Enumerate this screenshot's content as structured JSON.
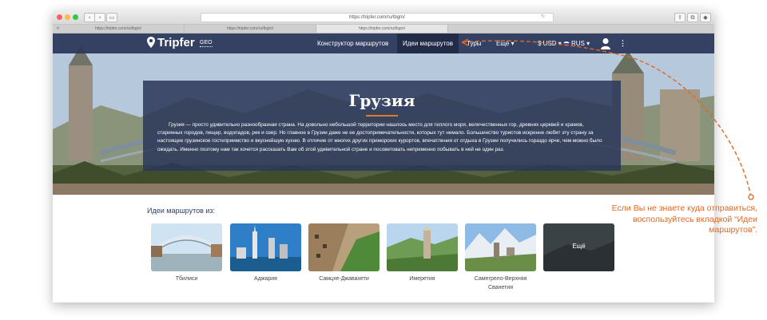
{
  "browser": {
    "url": "https://tripfer.com/ru/tbgm/",
    "tabs": [
      "https://tripfer.com/ru/tbgm/",
      "https://tripfer.com/ru/tbgm/",
      "https://tripfer.com/ru/tbgm/"
    ]
  },
  "site": {
    "brand": "Tripfer",
    "region": "GEO",
    "nav": {
      "constructor": "Конструктор маршрутов",
      "ideas": "Идеи маршрутов",
      "tours": "Туры",
      "more": "Ещё ▾",
      "currency": "$ USD ▾",
      "language": "RUS ▾"
    }
  },
  "hero": {
    "title": "Грузия",
    "description": "Грузия — просто удивительно разнообразная страна. На довольно небольшой территории нашлось место для теплого моря, величественных гор, древних церквей и храмов, старинных городов, пещер, водопадов, рек и озер. Но главное в Грузии даже не ее достопримечательности, которых тут немало. Большинство туристов искренне любят эту страну за настоящее грузинское гостеприимство и вкуснейшую кухню. В отличие от многих других приморских курортов, впечатления от отдыха в Грузии получились гораздо ярче, чем можно было ожидать. Именно поэтому нам так хочется рассказать Вам об этой удивительной стране и посоветовать непременно побывать в ней не один раз."
  },
  "ideas": {
    "title": "Идеи маршрутов из:",
    "cards": [
      "Тбилиси",
      "Аджария",
      "Самцхе-Джавахети",
      "Имеретия",
      "Самегрело-Верхняя Сванетия"
    ],
    "more": "Ещё"
  },
  "callout": {
    "text": "Если Вы не знаете куда отправиться, воспользуйтесь вкладкой “Идеи маршрутов”."
  },
  "colors": {
    "navbar": "#2b3758",
    "accent": "#e07a2c",
    "callout": "#e3671e"
  },
  "icons": [
    "map-pin-icon",
    "user-avatar-icon",
    "kebab-menu-icon",
    "russia-flag-icon"
  ]
}
